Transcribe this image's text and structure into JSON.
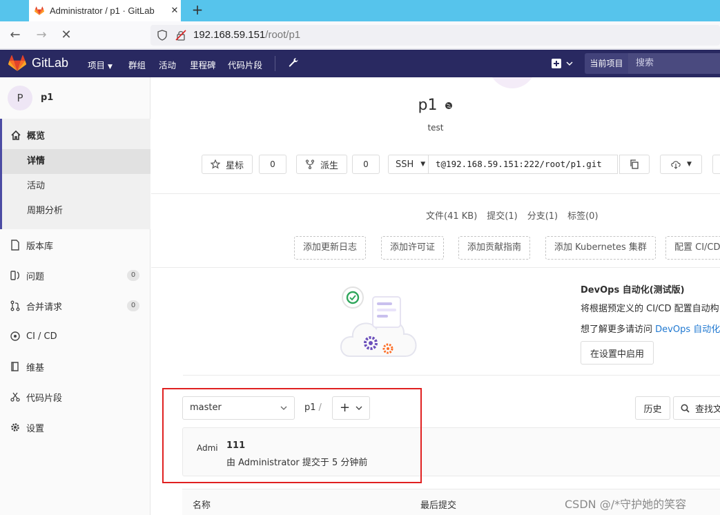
{
  "browser": {
    "tab_title": "Administrator / p1 · GitLab",
    "url_host": "192.168.59.151",
    "url_path": "/root/p1"
  },
  "header": {
    "brand": "GitLab",
    "nav": [
      "项目",
      "群组",
      "活动",
      "里程碑",
      "代码片段"
    ],
    "search_scope": "当前项目",
    "search_placeholder": "搜索"
  },
  "sidebar": {
    "project_initial": "P",
    "project_name": "p1",
    "overview_label": "概览",
    "overview_items": [
      "详情",
      "活动",
      "周期分析"
    ],
    "items": [
      {
        "label": "版本库",
        "icon": "doc-icon"
      },
      {
        "label": "问题",
        "icon": "issues-icon",
        "count": "0"
      },
      {
        "label": "合并请求",
        "icon": "merge-request-icon",
        "count": "0"
      },
      {
        "label": "CI / CD",
        "icon": "rocket-icon"
      },
      {
        "label": "维基",
        "icon": "book-icon"
      },
      {
        "label": "代码片段",
        "icon": "scissors-icon"
      },
      {
        "label": "设置",
        "icon": "gear-icon"
      }
    ]
  },
  "project": {
    "title": "p1",
    "description": "test",
    "star_label": "星标",
    "star_count": "0",
    "fork_label": "派生",
    "fork_count": "0",
    "clone_protocol": "SSH",
    "clone_url": "t@192.168.59.151:222/root/p1.git"
  },
  "stats": [
    "文件(41 KB)",
    "提交(1)",
    "分支(1)",
    "标签(0)"
  ],
  "quick_actions": [
    "添加更新日志",
    "添加许可证",
    "添加贡献指南",
    "添加 Kubernetes 集群",
    "配置 CI/CD"
  ],
  "devops": {
    "title": "DevOps 自动化(测试版)",
    "line1": "将根据预定义的 CI/CD 配置自动构",
    "line2_prefix": "想了解更多请访问 ",
    "line2_link": "DevOps 自动化",
    "enable_label": "在设置中启用"
  },
  "files": {
    "branch": "master",
    "path_root": "p1",
    "path_sep": "/",
    "history_label": "历史",
    "find_label": "查找文件"
  },
  "commit": {
    "avatar_alt": "Administrator",
    "message": "111",
    "meta": "由 Administrator 提交于 5 分钟前"
  },
  "table": {
    "col_name": "名称",
    "col_last_commit": "最后提交"
  },
  "watermark": "CSDN @/*守护她的笑容",
  "colors": {
    "header_bg": "#292961",
    "tab_strip": "#56c4ec",
    "highlight": "#e02020",
    "link": "#1f78d1"
  }
}
